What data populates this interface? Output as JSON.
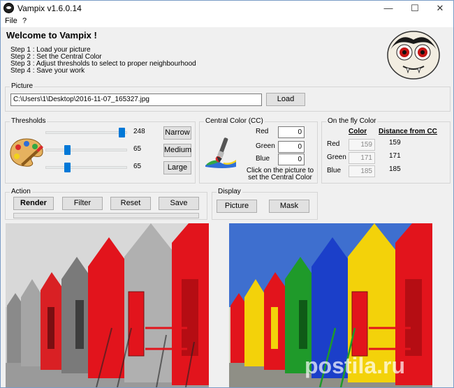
{
  "window": {
    "title": "Vampix v1.6.0.14"
  },
  "menu": {
    "file": "File",
    "help": "?"
  },
  "welcome": "Welcome to Vampix !",
  "steps": [
    "Step 1 : Load your picture",
    "Step 2 : Set the Central Color",
    "Step 3 : Adjust thresholds to select to proper neighbourhood",
    "Step 4 : Save your work"
  ],
  "picture": {
    "group_label": "Picture",
    "path": "C:\\Users\\1\\Desktop\\2016-11-07_165327.jpg",
    "load_label": "Load"
  },
  "thresholds": {
    "group_label": "Thresholds",
    "sliders": [
      {
        "value": "248",
        "level": 0.97
      },
      {
        "value": "65",
        "level": 0.25
      },
      {
        "value": "65",
        "level": 0.25
      }
    ],
    "narrow_label": "Narrow",
    "medium_label": "Medium",
    "large_label": "Large"
  },
  "central_color": {
    "group_label": "Central Color (CC)",
    "red_label": "Red",
    "red_value": "0",
    "green_label": "Green",
    "green_value": "0",
    "blue_label": "Blue",
    "blue_value": "0",
    "hint": "Click on the picture to set the Central Color"
  },
  "on_the_fly": {
    "group_label": "On the fly Color",
    "color_header": "Color",
    "distance_header": "Distance from CC",
    "rows": [
      {
        "label": "Red",
        "color": "159",
        "distance": "159"
      },
      {
        "label": "Green",
        "color": "171",
        "distance": "171"
      },
      {
        "label": "Blue",
        "color": "185",
        "distance": "185"
      }
    ]
  },
  "action": {
    "group_label": "Action",
    "render_label": "Render",
    "filter_label": "Filter",
    "reset_label": "Reset",
    "save_label": "Save",
    "progress": 0
  },
  "display": {
    "group_label": "Display",
    "picture_label": "Picture",
    "mask_label": "Mask"
  },
  "watermark": "postila.ru",
  "colors": {
    "accent": "#0078d7",
    "hut_red": "#e2141c",
    "hut_yellow": "#f3d20a",
    "hut_blue": "#1b3fc9",
    "hut_green": "#1f9a2a"
  }
}
